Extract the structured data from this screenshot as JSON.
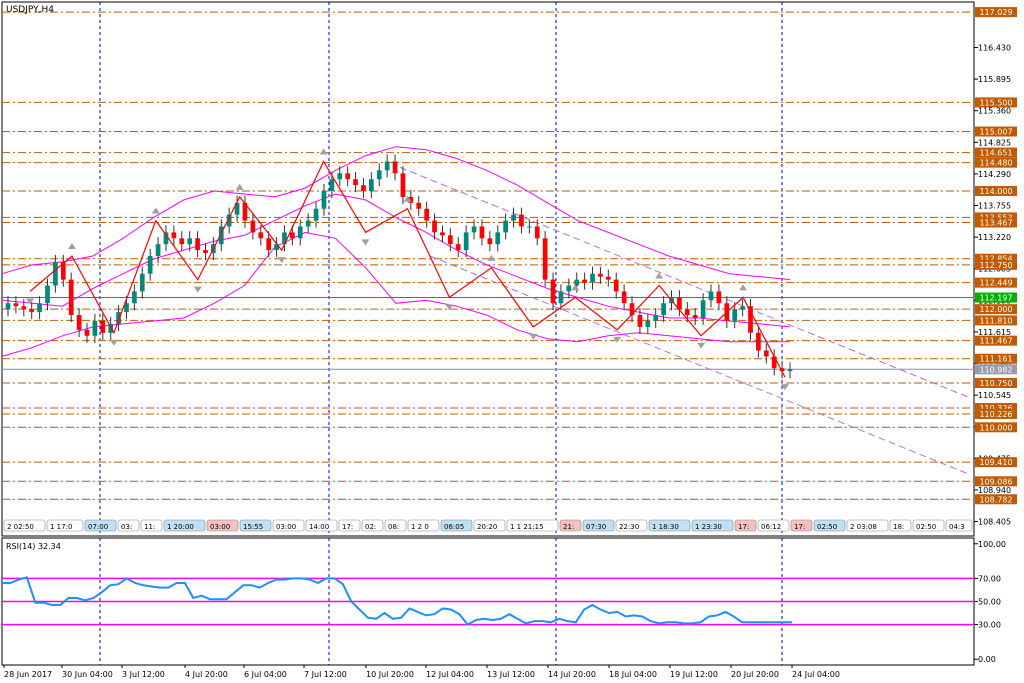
{
  "window": {
    "title": "USDJPY,H4",
    "rsi_title": "RSI(14) 32.34"
  },
  "colors": {
    "background": "#ffffff",
    "frame": "#000000",
    "level_line": "#c25a00",
    "level_label_bg": "#c25a00",
    "level_label_text": "#ffffff",
    "green_line": "#00b000",
    "grey_line": "#8c8ca0",
    "bollinger": "#ff00ff",
    "trend_channel": "#b074e0",
    "zigzag": "#ff0000",
    "bull_candle": "#00897b",
    "bear_candle": "#ff0000",
    "candle_wick": "#333333",
    "rsi_line": "#1e90ff",
    "rsi_levels": "#ff00ff",
    "vertical_separators": "#0000cc",
    "fractal_arrow": "#a0a0a0"
  },
  "price_axis": {
    "ylim": [
      108.16,
      117.2
    ],
    "ticks": [
      "116.430",
      "115.895",
      "115.360",
      "114.825",
      "114.290",
      "113.755",
      "113.220",
      "112.685",
      "112.150",
      "111.615",
      "111.080",
      "110.545",
      "110.010",
      "109.475",
      "108.940",
      "108.405"
    ]
  },
  "levels": [
    {
      "value": 117.029,
      "label": "117.029"
    },
    {
      "value": 115.5,
      "label": "115.500"
    },
    {
      "value": 115.007,
      "label": "115.007"
    },
    {
      "value": 114.651,
      "label": "114.651"
    },
    {
      "value": 114.48,
      "label": "114.480"
    },
    {
      "value": 114.0,
      "label": "114.000"
    },
    {
      "value": 113.553,
      "label": "113.553"
    },
    {
      "value": 113.467,
      "label": "113.467"
    },
    {
      "value": 112.854,
      "label": "112.854"
    },
    {
      "value": 112.75,
      "label": "112.750"
    },
    {
      "value": 112.449,
      "label": "112.449"
    },
    {
      "value": 112.0,
      "label": "112.000"
    },
    {
      "value": 111.81,
      "label": "111.810"
    },
    {
      "value": 111.467,
      "label": "111.467"
    },
    {
      "value": 111.161,
      "label": "111.161"
    },
    {
      "value": 110.75,
      "label": "110.750"
    },
    {
      "value": 110.326,
      "label": "110.326"
    },
    {
      "value": 110.226,
      "label": "110.226"
    },
    {
      "value": 110.0,
      "label": "110.000"
    },
    {
      "value": 109.41,
      "label": "109.410"
    },
    {
      "value": 109.086,
      "label": "109.086"
    },
    {
      "value": 108.782,
      "label": "108.782"
    }
  ],
  "highlight_levels": [
    {
      "value": 112.197,
      "label": "112.197",
      "style": "green"
    },
    {
      "value": 110.982,
      "label": "110.982",
      "style": "current"
    }
  ],
  "rsi_axis": {
    "ylim": [
      -5,
      105
    ],
    "ticks": [
      "100.00",
      "70.00",
      "50.00",
      "30.00",
      "0.00"
    ],
    "levels": [
      70,
      50,
      30
    ]
  },
  "time_axis": {
    "labels": [
      "28 Jun 2017",
      "30 Jun 04:00",
      "3 Jul 12:00",
      "4 Jul 20:00",
      "6 Jul 04:00",
      "7 Jul 12:00",
      "10 Jul 20:00",
      "12 Jul 04:00",
      "13 Jul 12:00",
      "14 Jul 20:00",
      "18 Jul 04:00",
      "19 Jul 12:00",
      "20 Jul 20:00",
      "24 Jul 04:00"
    ]
  },
  "time_strip": {
    "items": [
      {
        "text": "2 02:50",
        "style": "plain"
      },
      {
        "text": "1 17:0",
        "style": "plain"
      },
      {
        "text": "07:00",
        "style": "blue"
      },
      {
        "text": "03:",
        "style": "plain"
      },
      {
        "text": "11:",
        "style": "plain"
      },
      {
        "text": "1 20:00",
        "style": "blue"
      },
      {
        "text": "03:00",
        "style": "red"
      },
      {
        "text": "15:55",
        "style": "blue"
      },
      {
        "text": "03:00",
        "style": "plain"
      },
      {
        "text": "14:00",
        "style": "plain"
      },
      {
        "text": "17:",
        "style": "plain"
      },
      {
        "text": "02:",
        "style": "plain"
      },
      {
        "text": "08:",
        "style": "plain"
      },
      {
        "text": "1 2 0",
        "style": "plain"
      },
      {
        "text": "06:05",
        "style": "blue"
      },
      {
        "text": "20:20",
        "style": "plain"
      },
      {
        "text": "1 1 21:15",
        "style": "plain"
      },
      {
        "text": "21:",
        "style": "red"
      },
      {
        "text": "07:30",
        "style": "blue"
      },
      {
        "text": "22:30",
        "style": "plain"
      },
      {
        "text": "1 18:30",
        "style": "blue"
      },
      {
        "text": "1 23:30",
        "style": "blue"
      },
      {
        "text": "17:",
        "style": "red"
      },
      {
        "text": "06:12",
        "style": "plain"
      },
      {
        "text": "17:",
        "style": "red"
      },
      {
        "text": "02:50",
        "style": "blue"
      },
      {
        "text": "2 03:08",
        "style": "plain"
      },
      {
        "text": "18:",
        "style": "plain"
      },
      {
        "text": "02:50",
        "style": "plain"
      },
      {
        "text": "04:3",
        "style": "plain"
      },
      {
        "text": "2 02:50",
        "style": "plain"
      },
      {
        "text": "20",
        "style": "plain"
      }
    ]
  },
  "chart_data": [
    {
      "type": "candlestick",
      "title": "USDJPY,H4",
      "xlabel": "",
      "ylabel": "",
      "ylim": [
        108.16,
        117.2
      ],
      "close_series": [
        112.1,
        112.05,
        112.0,
        111.95,
        112.1,
        112.4,
        112.8,
        112.5,
        111.9,
        111.65,
        111.55,
        111.8,
        111.6,
        111.75,
        111.95,
        112.1,
        112.3,
        112.6,
        112.9,
        113.1,
        113.3,
        113.2,
        113.1,
        113.2,
        113.0,
        112.95,
        113.1,
        113.4,
        113.6,
        113.8,
        113.5,
        113.3,
        113.2,
        113.0,
        113.1,
        113.3,
        113.2,
        113.4,
        113.5,
        113.7,
        114.0,
        114.2,
        114.3,
        114.2,
        114.1,
        114.0,
        114.2,
        114.35,
        114.5,
        114.3,
        113.9,
        113.8,
        113.7,
        113.5,
        113.3,
        113.25,
        113.1,
        113.0,
        113.3,
        113.4,
        113.2,
        113.1,
        113.3,
        113.5,
        113.6,
        113.4,
        113.4,
        113.2,
        112.5,
        112.1,
        112.3,
        112.4,
        112.5,
        112.45,
        112.6,
        112.55,
        112.5,
        112.3,
        112.1,
        111.9,
        111.7,
        111.8,
        111.9,
        112.1,
        112.2,
        112.0,
        111.9,
        111.85,
        112.15,
        112.3,
        112.1,
        111.8,
        112.0,
        112.05,
        111.6,
        111.3,
        111.2,
        111.0,
        110.95,
        110.98
      ],
      "zigzag": [
        112.3,
        112.9,
        111.6,
        113.5,
        112.5,
        113.9,
        113.0,
        114.5,
        113.3,
        113.7,
        112.2,
        112.7,
        111.7,
        112.2,
        111.65,
        112.4,
        111.55,
        112.2,
        110.85
      ],
      "bollinger_upper": [
        112.6,
        112.75,
        112.8,
        112.9,
        113.2,
        113.55,
        113.85,
        114.0,
        113.95,
        113.9,
        114.05,
        114.35,
        114.6,
        114.75,
        114.7,
        114.55,
        114.35,
        114.1,
        113.8,
        113.5,
        113.3,
        113.1,
        112.9,
        112.75,
        112.6,
        112.55,
        112.5
      ],
      "bollinger_middle": [
        112.15,
        112.1,
        112.05,
        112.35,
        112.6,
        112.85,
        113.0,
        113.15,
        113.25,
        113.5,
        113.75,
        113.95,
        113.85,
        113.55,
        113.3,
        113.0,
        112.75,
        112.55,
        112.35,
        112.2,
        112.05,
        111.95,
        111.85,
        111.85,
        111.8,
        111.75,
        111.7
      ],
      "bollinger_lower": [
        111.2,
        111.35,
        111.55,
        111.7,
        111.75,
        111.8,
        111.85,
        112.1,
        112.4,
        113.05,
        113.3,
        113.2,
        112.7,
        112.1,
        112.15,
        112.05,
        111.9,
        111.65,
        111.5,
        111.45,
        111.55,
        111.6,
        111.55,
        111.5,
        111.45,
        111.45,
        111.45
      ],
      "trendlines": [
        {
          "from": 114.4,
          "to": 110.5
        },
        {
          "from": 112.9,
          "to": 109.2
        }
      ]
    },
    {
      "type": "line",
      "title": "RSI(14) 32.34",
      "xlabel": "",
      "ylabel": "",
      "ylim": [
        -5,
        105
      ],
      "values": [
        66,
        66,
        69,
        71,
        49,
        49,
        47,
        47,
        53,
        53,
        51,
        53,
        58,
        64,
        65,
        70,
        66,
        64,
        63,
        62,
        62,
        66,
        66,
        53,
        55,
        52,
        52,
        52,
        58,
        64,
        64,
        62,
        66,
        69,
        69,
        70,
        70,
        69,
        66,
        70,
        70,
        65,
        50,
        43,
        36,
        35,
        40,
        35,
        36,
        44,
        41,
        38,
        39,
        44,
        43,
        39,
        30,
        34,
        35,
        34,
        35,
        39,
        35,
        31,
        33,
        33,
        32,
        35,
        33,
        32,
        43,
        47,
        43,
        40,
        41,
        37,
        38,
        37,
        33,
        31,
        32,
        32,
        31,
        31,
        32,
        37,
        38,
        41,
        37,
        32,
        32,
        32,
        32,
        32,
        32,
        32
      ]
    }
  ]
}
